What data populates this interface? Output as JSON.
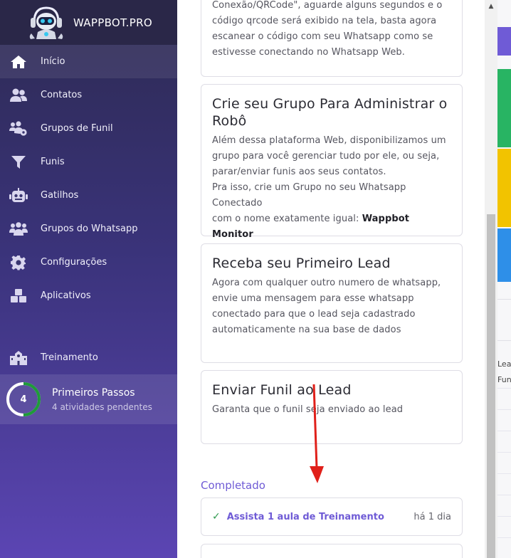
{
  "sidebar": {
    "brand": "WAPPBOT.PRO",
    "items": [
      {
        "label": "Início",
        "icon": "home-icon"
      },
      {
        "label": "Contatos",
        "icon": "users-icon"
      },
      {
        "label": "Grupos de Funil",
        "icon": "users-gear-icon"
      },
      {
        "label": "Funis",
        "icon": "filter-icon"
      },
      {
        "label": "Gatilhos",
        "icon": "robot-icon"
      },
      {
        "label": "Grupos do Whatsapp",
        "icon": "users-group-icon"
      },
      {
        "label": "Configurações",
        "icon": "gear-icon"
      },
      {
        "label": "Aplicativos",
        "icon": "cubes-icon"
      }
    ],
    "training": {
      "label": "Treinamento",
      "icon": "school-icon"
    },
    "steps": {
      "count": "4",
      "title": "Primeiros Passos",
      "subtitle": "4 atividades pendentes",
      "progress": 0.5
    }
  },
  "main": {
    "card0": {
      "line1": "Conexão/QRCode\", aguarde alguns segundos e o",
      "line2": "código qrcode será exibido na tela, basta agora",
      "line3": "escanear o código com seu Whatsapp como se",
      "line4": "estivesse conectando no Whatsapp Web."
    },
    "card1": {
      "title_l1": "Crie seu Grupo Para Administrar o",
      "title_l2": "Robô",
      "body_l1": "Além dessa plataforma Web, disponibilizamos um",
      "body_l2": "grupo para você gerenciar tudo por ele, ou seja,",
      "body_l3": "parar/enviar funis aos seus contatos.",
      "body_l4": "Pra isso, crie um Grupo no seu Whatsapp Conectado",
      "body_l5": "com o nome exatamente igual: ",
      "body_bold": "Wappbot Monitor"
    },
    "card2": {
      "title": "Receba seu Primeiro Lead",
      "body_l1": "Agora com qualquer outro numero de whatsapp,",
      "body_l2": "envie uma mensagem para esse whatsapp",
      "body_l3": "conectado para que o lead seja cadastrado",
      "body_l4": "automaticamente na sua base de dados"
    },
    "card3": {
      "title": "Enviar Funil ao Lead",
      "body": "Garanta que o funil seja enviado ao lead"
    },
    "completed_label": "Completado",
    "completed_item": {
      "check": "✓",
      "label": "Assista 1 aula de Treinamento",
      "time": "há 1 dia"
    }
  },
  "background": {
    "text1": "Lea",
    "text2": "Fun"
  },
  "colors": {
    "accent": "#6f5bd6",
    "arrow": "#e0201a",
    "progress": "#1f9a3a"
  }
}
